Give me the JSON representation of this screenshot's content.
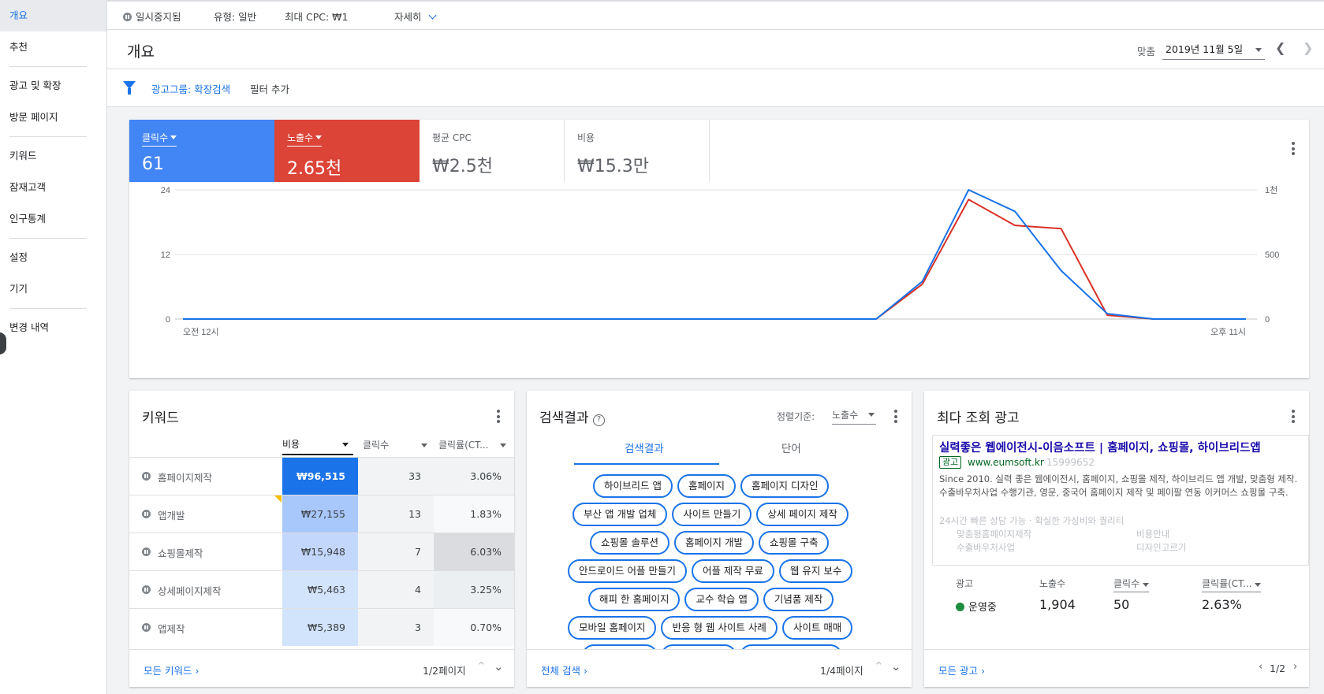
{
  "sidebar": {
    "items": [
      {
        "label": "개요"
      },
      {
        "label": "추천"
      },
      {
        "label": "광고 및 확장"
      },
      {
        "label": "방문 페이지"
      },
      {
        "label": "키워드"
      },
      {
        "label": "잠재고객"
      },
      {
        "label": "인구통계"
      },
      {
        "label": "설정"
      },
      {
        "label": "기기"
      },
      {
        "label": "변경 내역"
      }
    ]
  },
  "topbar": {
    "status": "일시중지됨",
    "type": "유형: 일반",
    "max_cpc": "최대 CPC: ₩1",
    "details": "자세히"
  },
  "header": {
    "title": "개요",
    "date_label": "맞춤",
    "date_value": "2019년 11월 5일"
  },
  "filter": {
    "chip": "광고그룹: 확장검색",
    "add": "필터 추가"
  },
  "metrics": [
    {
      "label": "클릭수",
      "value": "61",
      "color": "#4285f4"
    },
    {
      "label": "노출수",
      "value": "2.65천",
      "color": "#db4437"
    },
    {
      "label": "평균 CPC",
      "value": "₩2.5천"
    },
    {
      "label": "비용",
      "value": "₩15.3만"
    }
  ],
  "chart_data": {
    "type": "line",
    "x": [
      "0",
      "1",
      "2",
      "3",
      "4",
      "5",
      "6",
      "7",
      "8",
      "9",
      "10",
      "11",
      "12",
      "13",
      "14",
      "15",
      "16",
      "17",
      "18",
      "19",
      "20",
      "21",
      "22",
      "23"
    ],
    "x_tick_labels": [
      "오전 12시",
      "오후 11시"
    ],
    "y_left_ticks": [
      "0",
      "12",
      "24"
    ],
    "y_right_ticks": [
      "0",
      "500",
      "1천"
    ],
    "ylim_left": [
      0,
      24
    ],
    "ylim_right": [
      0,
      1000
    ],
    "grid": true,
    "series": [
      {
        "name": "클릭수",
        "axis": "left",
        "color": "#1a73e8",
        "values": [
          0,
          0,
          0,
          0,
          0,
          0,
          0,
          0,
          0,
          0,
          0,
          0,
          0,
          0,
          0,
          0,
          7,
          24,
          20,
          9,
          1,
          0,
          0,
          0
        ]
      },
      {
        "name": "노출수",
        "axis": "right",
        "color": "#d93025",
        "values": [
          0,
          0,
          0,
          0,
          0,
          0,
          0,
          0,
          0,
          0,
          0,
          0,
          0,
          0,
          0,
          0,
          270,
          925,
          725,
          700,
          30,
          0,
          0,
          0
        ]
      }
    ]
  },
  "keywords": {
    "title": "키워드",
    "columns": [
      "비용",
      "클릭수",
      "클릭률(CT..."
    ],
    "rows": [
      {
        "name": "홈페이지제작",
        "cost": "₩96,515",
        "clicks": "33",
        "ctr": "3.06%"
      },
      {
        "name": "앱개발",
        "cost": "₩27,155",
        "clicks": "13",
        "ctr": "1.83%"
      },
      {
        "name": "쇼핑몰제작",
        "cost": "₩15,948",
        "clicks": "7",
        "ctr": "6.03%"
      },
      {
        "name": "상세페이지제작",
        "cost": "₩5,463",
        "clicks": "4",
        "ctr": "3.25%"
      },
      {
        "name": "앱제작",
        "cost": "₩5,389",
        "clicks": "3",
        "ctr": "0.70%"
      }
    ],
    "footer_link": "모든 키워드",
    "pager": "1/2페이지"
  },
  "search_terms": {
    "title": "검색결과",
    "sort_label": "정렬기준:",
    "sort_value": "노출수",
    "tabs": [
      "검색결과",
      "단어"
    ],
    "chips": [
      "하이브리드 앱",
      "홈페이지",
      "홈페이지 디자인",
      "부산 앱 개발 업체",
      "사이트 만들기",
      "상세 페이지 제작",
      "쇼핑몰 솔루션",
      "홈페이지 개발",
      "쇼핑몰 구축",
      "안드로이드 어플 만들기",
      "어플 제작 무료",
      "웹 유지 보수",
      "해피 한 홈페이지",
      "교수 학습 앱",
      "기념품 제작",
      "모바일 홈페이지",
      "반응 형 웹 사이트 사례",
      "사이트 매매"
    ],
    "footer_link": "전체 검색",
    "pager": "1/4페이지"
  },
  "top_ad": {
    "title": "최다 조회 광고",
    "headline": "실력좋은 웹에이전시-이음소프트 | 홈페이지, 쇼핑몰, 하이브리드앱",
    "badge": "광고",
    "url": "www.eumsoft.kr",
    "phone": "15999652",
    "description": "Since 2010. 실력 좋은 웹에이전시, 홈페이지, 쇼핑몰 제작, 하이브리드 앱 개발, 맞춤형 제작. 수출바우처사업 수행기관, 영문, 중국어 홈페이지 제작 및 페이팔 연동 이커머스 쇼핑몰 구축.",
    "callout": "24시간 빠른 상담 가능 · 확실한 가성비와 퀄리티",
    "sitelinks": [
      "맞춤형홈페이지제작",
      "비용안내",
      "수출바우처사업",
      "디자인고르기"
    ],
    "stats": [
      {
        "label": "광고",
        "value": "운영중"
      },
      {
        "label": "노출수",
        "value": "1,904"
      },
      {
        "label": "클릭수",
        "value": "50"
      },
      {
        "label": "클릭률(CT...",
        "value": "2.63%"
      }
    ],
    "footer_link": "모든 광고",
    "pager": "1/2"
  }
}
